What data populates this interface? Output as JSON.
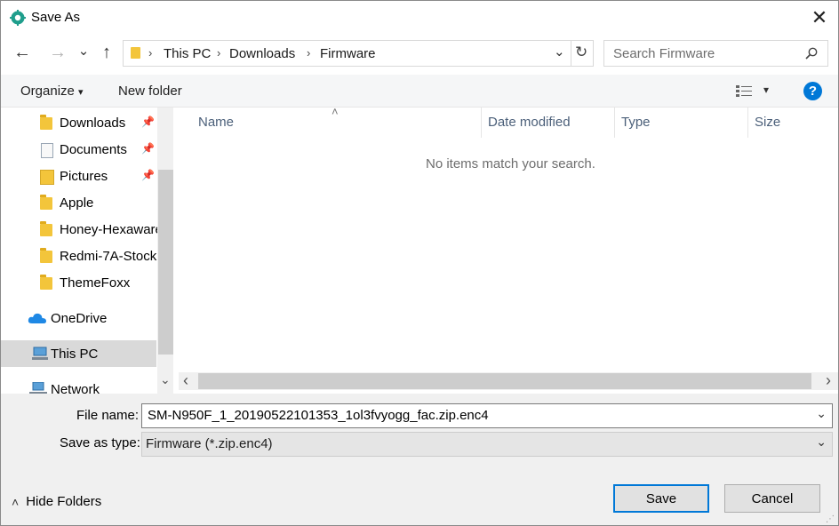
{
  "window": {
    "title": "Save As",
    "close_glyph": "✕"
  },
  "nav": {
    "back_glyph": "←",
    "forward_glyph": "→",
    "recent_glyph": "⌄",
    "up_glyph": "↑",
    "breadcrumb": [
      "This PC",
      "Downloads",
      "Firmware"
    ],
    "separator": "›",
    "dropdown_glyph": "⌄",
    "refresh_glyph": "↻",
    "search_placeholder": "Search Firmware"
  },
  "commandbar": {
    "organize_label": "Organize",
    "organize_arrow": "▾",
    "new_folder_label": "New folder",
    "view_arrow": "▾",
    "help_glyph": "?"
  },
  "sidebar": {
    "items": [
      {
        "label": "Downloads",
        "icon": "download-folder-icon",
        "pinned": true
      },
      {
        "label": "Documents",
        "icon": "documents-icon",
        "pinned": true
      },
      {
        "label": "Pictures",
        "icon": "pictures-icon",
        "pinned": true
      },
      {
        "label": "Apple",
        "icon": "folder-icon"
      },
      {
        "label": "Honey-Hexaware",
        "icon": "folder-icon"
      },
      {
        "label": "Redmi-7A-Stock",
        "icon": "folder-icon"
      },
      {
        "label": "ThemeFoxx",
        "icon": "folder-icon"
      },
      {
        "label": "OneDrive",
        "icon": "onedrive-icon"
      },
      {
        "label": "This PC",
        "icon": "pc-icon",
        "selected": true
      },
      {
        "label": "Network",
        "icon": "network-icon"
      }
    ],
    "pin_glyph": "📌",
    "scroll_down_glyph": "⌄"
  },
  "filelist": {
    "columns": [
      "Name",
      "Date modified",
      "Type",
      "Size"
    ],
    "sort_glyph": "˄",
    "empty_message": "No items match your search.",
    "scroll_left_glyph": "‹",
    "scroll_right_glyph": "›"
  },
  "form": {
    "file_name_label": "File name:",
    "file_name_value": "SM-N950F_1_20190522101353_1ol3fvyogg_fac.zip.enc4",
    "save_type_label": "Save as type:",
    "save_type_value": "Firmware (*.zip.enc4)",
    "chevron": "⌄"
  },
  "footer": {
    "hide_folders_label": "Hide Folders",
    "hide_folders_glyph": "˄",
    "save_label": "Save",
    "cancel_label": "Cancel"
  },
  "colors": {
    "accent": "#0078d7",
    "selection": "#d9d9d9",
    "folder": "#f3c53b"
  }
}
